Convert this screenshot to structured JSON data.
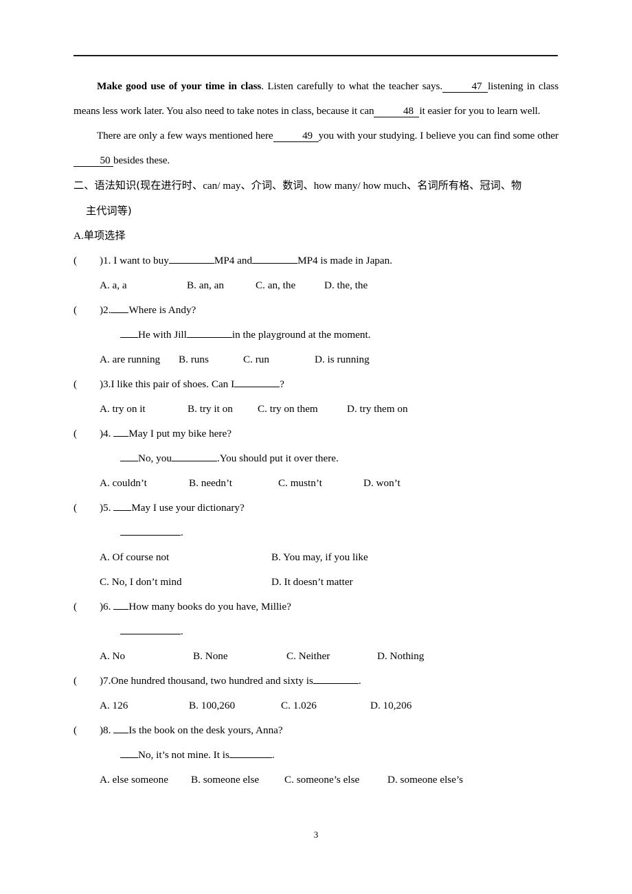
{
  "document": {
    "page_number": "3",
    "header_rule": true
  },
  "cloze": {
    "para1": {
      "bold_lead": "Make good use of your time in class",
      "text_a": ". Listen carefully to what the teacher says.",
      "blank_47": "47",
      "text_b": "listening in class means less work later. You also need to take notes in class, because it can",
      "blank_48": "48",
      "text_c": "it easier for you to learn well."
    },
    "para2": {
      "text_a": "There are only a few ways mentioned here",
      "blank_49": "49",
      "text_b": "you with your studying. I believe you can find some other",
      "blank_50": "50",
      "text_c": "besides these."
    }
  },
  "section": {
    "heading_line1": "二、语法知识(现在进行时、can/ may、介词、数词、how many/ how much、名词所有格、冠词、物",
    "heading_line2": "主代词等)",
    "heading_cn_a": "二、语法知识(现在进行时、",
    "heading_en_a": "can/ may",
    "heading_cn_b": "、介词、数词、",
    "heading_en_b": "how many/ how much",
    "heading_cn_c": "、名词所有格、冠词、物",
    "subsection_label": "A.单项选择",
    "subsection_letter": "A.",
    "subsection_cn": "单项选择"
  },
  "questions": [
    {
      "paren": "(",
      "number_text": ")1. I want to buy",
      "stem_mid": "MP4 and",
      "stem_tail": "MP4 is made in Japan.",
      "options": [
        "A. a, a",
        "B. an, an",
        "C. an, the",
        "D. the, the"
      ]
    },
    {
      "paren": "(",
      "number_text": ")2.",
      "prompt": "Where is Andy?",
      "reply_a": "He with Jill",
      "reply_b": "in the playground at the moment.",
      "options": [
        "A. are running",
        "B. runs",
        "C. run",
        "D. is running"
      ]
    },
    {
      "paren": "(",
      "number_text": ")3.I like this pair of shoes. Can I",
      "stem_tail": "?",
      "options": [
        "A. try on it",
        "B. try it on",
        "C. try on them",
        "D. try them on"
      ]
    },
    {
      "paren": "(",
      "number_text": ")4.",
      "prompt": "May I put my bike here?",
      "reply_a": "No, you",
      "reply_b": ".You should put it over there.",
      "options": [
        "A. couldn’t",
        "B. needn’t",
        "C. mustn’t",
        "D. won’t"
      ]
    },
    {
      "paren": "(",
      "number_text": ")5.",
      "prompt": "May I use your dictionary?",
      "reply_a": "",
      "reply_b": ".",
      "options": [
        "A. Of course not",
        "B. You may, if you like",
        "C. No, I don’t mind",
        "D. It doesn’t matter"
      ]
    },
    {
      "paren": "(",
      "number_text": ")6.",
      "prompt": "How many books do you have, Millie?",
      "reply_a": "",
      "reply_b": ".",
      "options": [
        "A. No",
        "B. None",
        "C. Neither",
        "D. Nothing"
      ]
    },
    {
      "paren": "(",
      "number_text": ")7.One hundred thousand, two hundred and sixty is",
      "stem_tail": ".",
      "options": [
        "A. 126",
        "B. 100,260",
        "C. 1.026",
        "D. 10,206"
      ]
    },
    {
      "paren": "(",
      "number_text": ")8.",
      "prompt": "Is the book on the desk yours, Anna?",
      "reply_a": "No, it’s not mine. It is",
      "reply_b": ".",
      "options": [
        "A. else someone",
        "B. someone else",
        "C. someone’s else",
        "D. someone else’s"
      ]
    }
  ]
}
